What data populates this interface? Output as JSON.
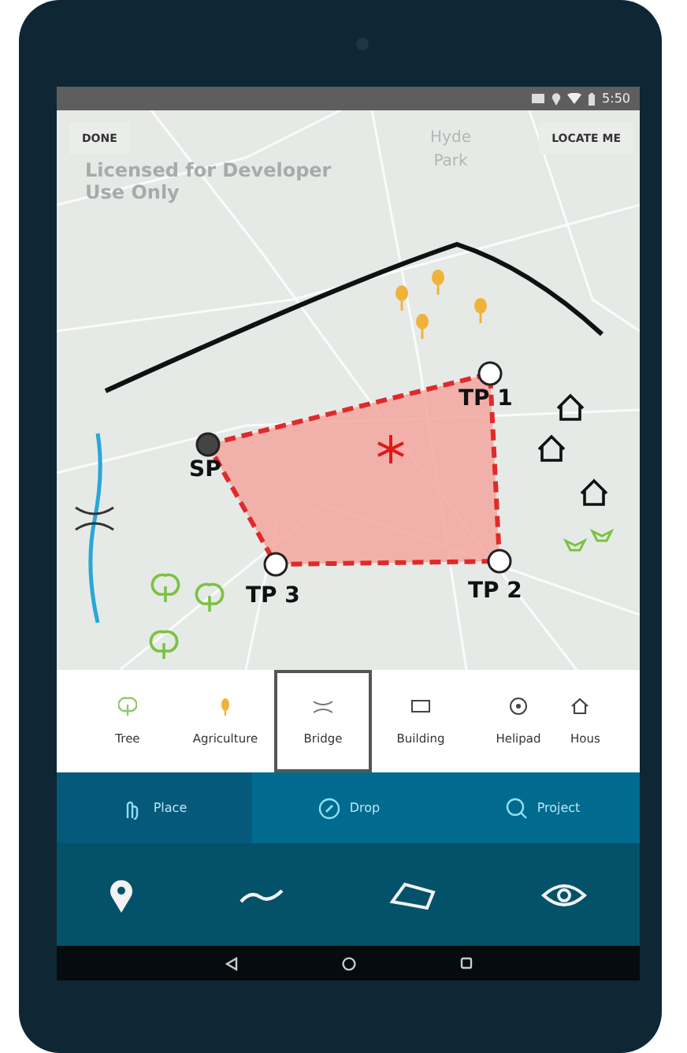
{
  "status_bar": {
    "time": "5:50"
  },
  "map": {
    "done_button": "DONE",
    "locate_button": "LOCATE ME",
    "license_text": "Licensed for Developer Use Only",
    "place_label": "Hyde Park",
    "points": [
      {
        "label": "SP",
        "kind": "start"
      },
      {
        "label": "TP 1",
        "kind": "turn"
      },
      {
        "label": "TP 2",
        "kind": "turn"
      },
      {
        "label": "TP 3",
        "kind": "turn"
      }
    ]
  },
  "palette": [
    {
      "label": "Tree",
      "selected": false
    },
    {
      "label": "Agriculture",
      "selected": false
    },
    {
      "label": "Bridge",
      "selected": true
    },
    {
      "label": "Building",
      "selected": false
    },
    {
      "label": "Helipad",
      "selected": false
    },
    {
      "label": "Hous",
      "selected": false
    }
  ],
  "modes": [
    {
      "label": "Place",
      "selected": true
    },
    {
      "label": "Drop",
      "selected": false
    },
    {
      "label": "Project",
      "selected": false
    }
  ]
}
